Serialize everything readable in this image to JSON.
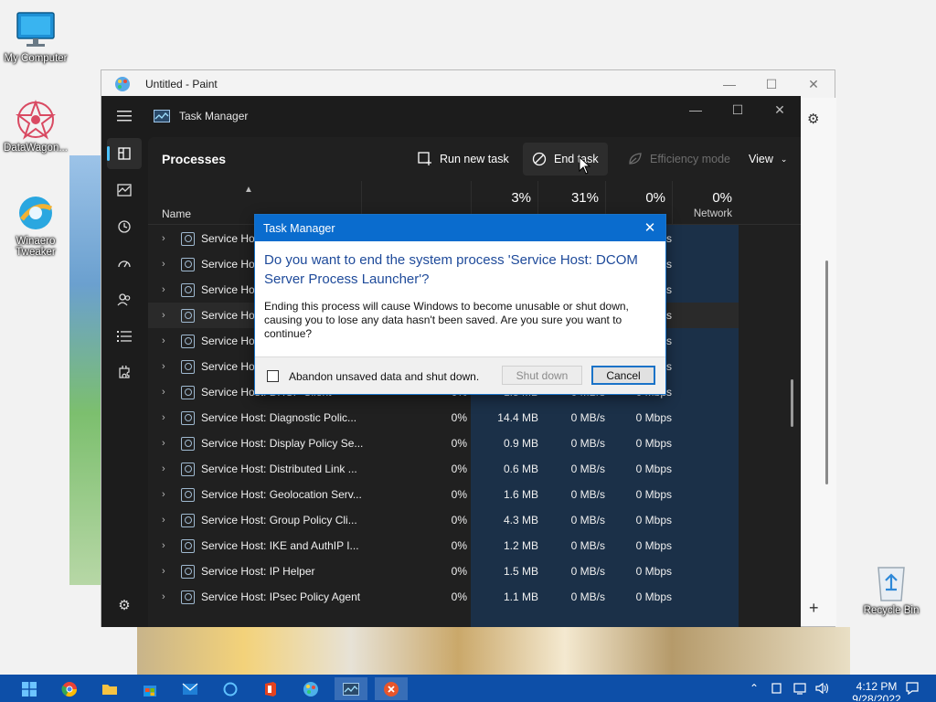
{
  "desktop": {
    "icons": [
      {
        "label": "My Computer"
      },
      {
        "label": "DataWagon..."
      },
      {
        "label": "Winaero Tweaker"
      },
      {
        "label": "Recycle Bin"
      }
    ]
  },
  "paint": {
    "title": "Untitled - Paint"
  },
  "task_manager": {
    "title": "Task Manager",
    "heading": "Processes",
    "toolbar": {
      "run_new_task": "Run new task",
      "end_task": "End task",
      "efficiency_mode": "Efficiency mode",
      "view": "View"
    },
    "columns": {
      "name": "Name",
      "cpu_pct": "3%",
      "memory_pct": "31%",
      "disk_pct": "0%",
      "network_pct": "0%",
      "network_label": "Network"
    },
    "rows": [
      {
        "name": "Service Hos",
        "cpu": "",
        "mem": "",
        "disk": "",
        "net": "0 Mbps"
      },
      {
        "name": "Service Hos",
        "cpu": "",
        "mem": "",
        "disk": "",
        "net": "0 Mbps"
      },
      {
        "name": "Service Hos",
        "cpu": "",
        "mem": "",
        "disk": "",
        "net": "0 Mbps"
      },
      {
        "name": "Service Hos",
        "cpu": "",
        "mem": "",
        "disk": "",
        "net": "0 Mbps"
      },
      {
        "name": "Service Hos",
        "cpu": "",
        "mem": "",
        "disk": "",
        "net": "0 Mbps"
      },
      {
        "name": "Service Hos",
        "cpu": "",
        "mem": "",
        "disk": "",
        "net": "0 Mbps"
      },
      {
        "name": "Service Host: DHCP Client",
        "cpu": "0%",
        "mem": "1.5 MB",
        "disk": "0 MB/s",
        "net": "0 Mbps"
      },
      {
        "name": "Service Host: Diagnostic Polic...",
        "cpu": "0%",
        "mem": "14.4 MB",
        "disk": "0 MB/s",
        "net": "0 Mbps"
      },
      {
        "name": "Service Host: Display Policy Se...",
        "cpu": "0%",
        "mem": "0.9 MB",
        "disk": "0 MB/s",
        "net": "0 Mbps"
      },
      {
        "name": "Service Host: Distributed Link ...",
        "cpu": "0%",
        "mem": "0.6 MB",
        "disk": "0 MB/s",
        "net": "0 Mbps"
      },
      {
        "name": "Service Host: Geolocation Serv...",
        "cpu": "0%",
        "mem": "1.6 MB",
        "disk": "0 MB/s",
        "net": "0 Mbps"
      },
      {
        "name": "Service Host: Group Policy Cli...",
        "cpu": "0%",
        "mem": "4.3 MB",
        "disk": "0 MB/s",
        "net": "0 Mbps"
      },
      {
        "name": "Service Host: IKE and AuthIP I...",
        "cpu": "0%",
        "mem": "1.2 MB",
        "disk": "0 MB/s",
        "net": "0 Mbps"
      },
      {
        "name": "Service Host: IP Helper",
        "cpu": "0%",
        "mem": "1.5 MB",
        "disk": "0 MB/s",
        "net": "0 Mbps"
      },
      {
        "name": "Service Host: IPsec Policy Agent",
        "cpu": "0%",
        "mem": "1.1 MB",
        "disk": "0 MB/s",
        "net": "0 Mbps"
      }
    ]
  },
  "dialog": {
    "title": "Task Manager",
    "main": "Do you want to end the system process 'Service Host: DCOM Server Process Launcher'?",
    "body": "Ending this process will cause Windows to become unusable or shut down, causing you to lose any data hasn't been saved. Are you sure you want to continue?",
    "checkbox_label": "Abandon unsaved data and shut down.",
    "shutdown_label": "Shut down",
    "cancel_label": "Cancel"
  },
  "taskbar": {
    "time": "4:12 PM",
    "date": "9/28/2022"
  },
  "colors": {
    "accent": "#0a6cce",
    "tm_background": "#202020",
    "taskbar": "#0d4fa8",
    "heat_column": "#1b3048"
  }
}
